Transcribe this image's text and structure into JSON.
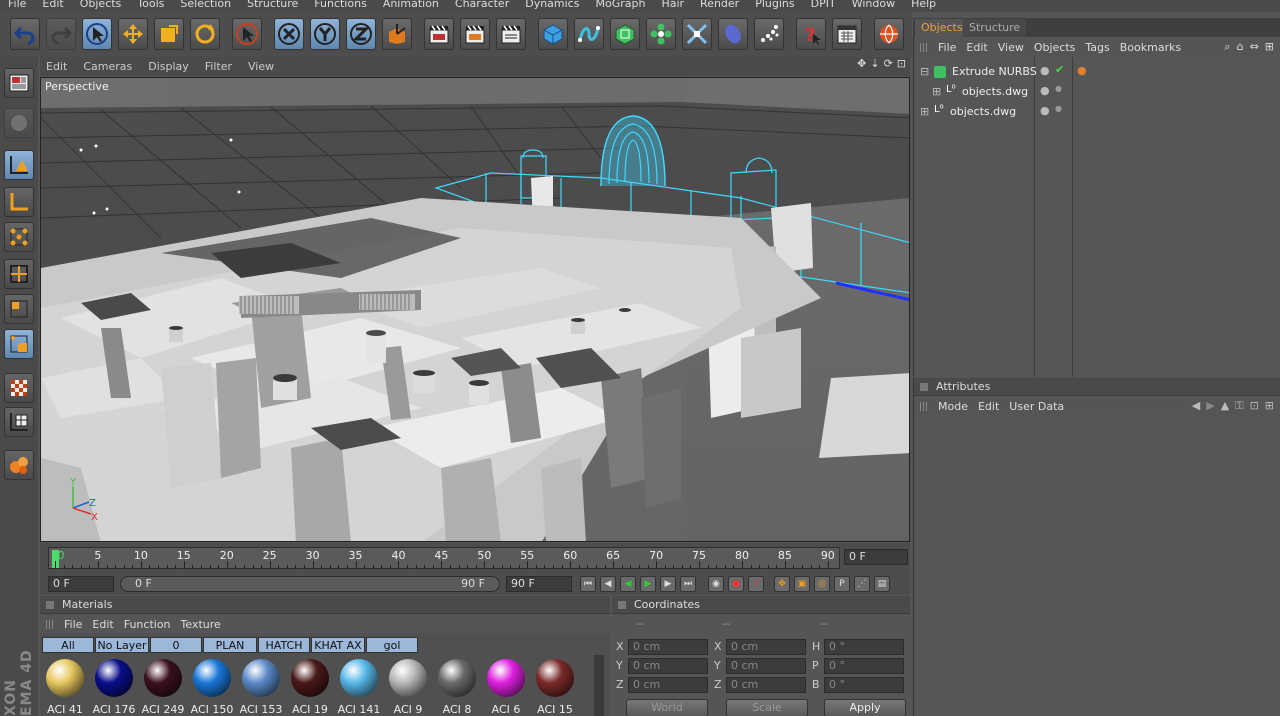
{
  "menu": [
    "File",
    "Edit",
    "Objects",
    "Tools",
    "Selection",
    "Structure",
    "Functions",
    "Animation",
    "Character",
    "Dynamics",
    "MoGraph",
    "Hair",
    "Render",
    "Plugins",
    "DPIT",
    "Window",
    "Help"
  ],
  "viewport": {
    "menu": [
      "Edit",
      "Cameras",
      "Display",
      "Filter",
      "View"
    ],
    "label": "Perspective",
    "nav": [
      "✥",
      "⇣",
      "⟳",
      "⊡"
    ]
  },
  "timeline": {
    "ticks": [
      "0",
      "5",
      "10",
      "15",
      "20",
      "25",
      "30",
      "35",
      "40",
      "45",
      "50",
      "55",
      "60",
      "65",
      "70",
      "75",
      "80",
      "85",
      "90"
    ],
    "current_frame": "0 F",
    "start_frame": "0 F",
    "range_start": "0 F",
    "range_end": "90 F",
    "end_frame": "90 F"
  },
  "materials": {
    "title": "Materials",
    "menu": [
      "File",
      "Edit",
      "Function",
      "Texture"
    ],
    "layers": [
      "All",
      "No Layer",
      "0",
      "PLAN",
      "HATCH",
      "KHAT AX",
      "gol"
    ],
    "items": [
      {
        "name": "ACI 41",
        "color": "#e8c860"
      },
      {
        "name": "ACI 176",
        "color": "#0a0e8a"
      },
      {
        "name": "ACI 249",
        "color": "#3a1020"
      },
      {
        "name": "ACI 150",
        "color": "#1a78d8"
      },
      {
        "name": "ACI 153",
        "color": "#5a8ac8"
      },
      {
        "name": "ACI 19",
        "color": "#4a1818"
      },
      {
        "name": "ACI 141",
        "color": "#58b8e8"
      },
      {
        "name": "ACI 9",
        "color": "#b8b8b8"
      },
      {
        "name": "ACI 8",
        "color": "#6a6a6a"
      },
      {
        "name": "ACI 6",
        "color": "#e020e0"
      },
      {
        "name": "ACI 15",
        "color": "#7a2a2a"
      }
    ]
  },
  "coordinates": {
    "title": "Coordinates",
    "col_headers": [
      "--",
      "--",
      "--"
    ],
    "rows": [
      {
        "a": "X",
        "v1": "0 cm",
        "b": "X",
        "v2": "0 cm",
        "c": "H",
        "v3": "0 °"
      },
      {
        "a": "Y",
        "v1": "0 cm",
        "b": "Y",
        "v2": "0 cm",
        "c": "P",
        "v3": "0 °"
      },
      {
        "a": "Z",
        "v1": "0 cm",
        "b": "Z",
        "v2": "0 cm",
        "c": "B",
        "v3": "0 °"
      }
    ],
    "mode1": "World",
    "mode2": "Scale",
    "apply": "Apply"
  },
  "objects": {
    "tabs": [
      "Objects",
      "Structure"
    ],
    "menu": [
      "File",
      "Edit",
      "View",
      "Objects",
      "Tags",
      "Bookmarks"
    ],
    "tree": [
      {
        "name": "Extrude NURBS",
        "indent": 0
      },
      {
        "name": "objects.dwg",
        "indent": 1
      },
      {
        "name": "objects.dwg",
        "indent": 0
      }
    ]
  },
  "attributes": {
    "title": "Attributes",
    "menu": [
      "Mode",
      "Edit",
      "User Data"
    ]
  },
  "brand": "XON EMA 4D",
  "colors": {
    "accent": "#e8a040",
    "selection": "#8fb4d8",
    "playhead": "#4ddc6a",
    "cyan": "#40e0e0"
  }
}
